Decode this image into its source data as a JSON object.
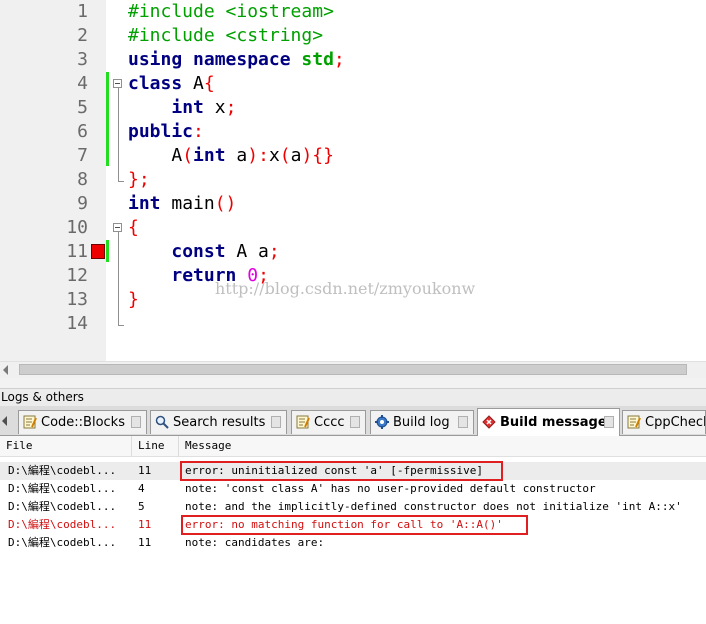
{
  "editor": {
    "line_numbers": [
      "1",
      "2",
      "3",
      "4",
      "5",
      "6",
      "7",
      "8",
      "9",
      "10",
      "11",
      "12",
      "13",
      "14"
    ],
    "code": {
      "l1": "#include <iostream>",
      "l2": "#include <cstring>",
      "l3_kw": "using namespace",
      "l3_std": "std",
      "l3_semi": ";",
      "l4_kw": "class",
      "l4_name": " A",
      "l4_brace": "{",
      "l5_kw": "int",
      "l5_rest": " x",
      "l5_semi": ";",
      "l6_kw": "public",
      "l6_colon": ":",
      "l7_a": "A",
      "l7_paren": "(",
      "l7_kw": "int",
      "l7_b": " a",
      "l7_close": "):",
      "l7_c": "x",
      "l7_p2": "(",
      "l7_d": "a",
      "l7_end": "){}",
      "l8": "};",
      "l9_kw": "int",
      "l9_name": " main",
      "l9_paren": "()",
      "l10": "{",
      "l11_kw": "const",
      "l11_rest": " A a",
      "l11_semi": ";",
      "l12_kw": "return",
      "l12_num": " 0",
      "l12_semi": ";",
      "l13": "}"
    },
    "watermark": "http://blog.csdn.net/zmyoukonw"
  },
  "logs": {
    "title": "Logs & others",
    "tabs": [
      {
        "label": "Code::Blocks",
        "icon": "notepad-icon"
      },
      {
        "label": "Search results",
        "icon": "search-icon"
      },
      {
        "label": "Cccc",
        "icon": "notepad-icon"
      },
      {
        "label": "Build log",
        "icon": "gear-icon"
      },
      {
        "label": "Build messages",
        "icon": "diamond-icon"
      },
      {
        "label": "CppCheck",
        "icon": "notepad-icon"
      }
    ],
    "active_tab": "Build messages",
    "columns": {
      "file": "File",
      "line": "Line",
      "message": "Message"
    },
    "rows": [
      {
        "file": "D:\\編程\\codebl...",
        "line": "11",
        "message": "error: uninitialized const 'a' [-fpermissive]"
      },
      {
        "file": "D:\\編程\\codebl...",
        "line": "4",
        "message": "note: 'const class A' has no user-provided default constructor"
      },
      {
        "file": "D:\\編程\\codebl...",
        "line": "5",
        "message": "note: and the implicitly-defined constructor does not initialize 'int A::x'"
      },
      {
        "file": "D:\\編程\\codebl...",
        "line": "11",
        "message": "error: no matching function for call to 'A::A()'"
      },
      {
        "file": "D:\\編程\\codebl...",
        "line": "11",
        "message": "note: candidates are:"
      }
    ]
  },
  "colors": {
    "preprocessor": "#00a000",
    "keyword": "#000080",
    "operator": "#ee0000",
    "number": "#e000e0",
    "error_text": "#d01010",
    "highlight_box": "#e02020",
    "breakpoint": "#ee0000",
    "changed_marker": "#22dd22"
  }
}
